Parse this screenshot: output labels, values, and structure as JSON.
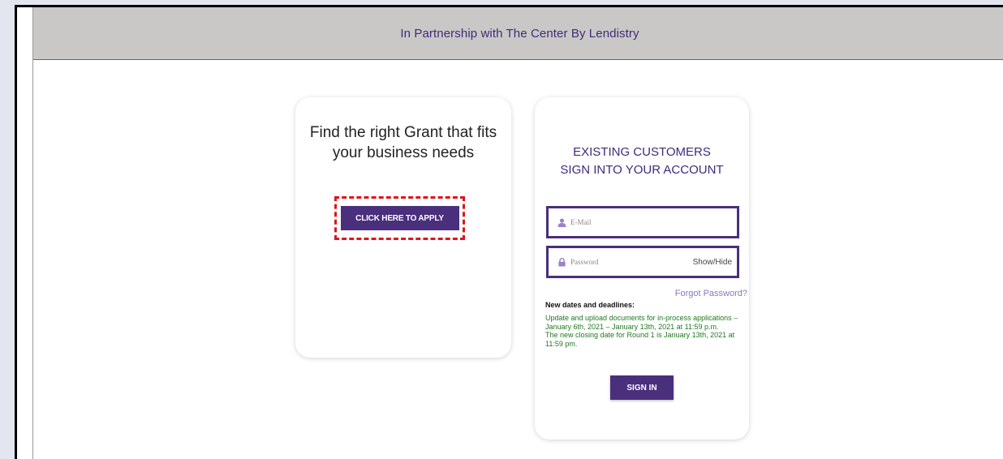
{
  "banner": {
    "text": "In Partnership with The Center By Lendistry"
  },
  "grant_card": {
    "heading": "Find the right Grant that fits your business needs",
    "apply_button_label": "CLICK HERE TO APPLY"
  },
  "login_card": {
    "title_line1": "EXISTING CUSTOMERS",
    "title_line2": "SIGN INTO YOUR ACCOUNT",
    "email_placeholder": "E-Mail",
    "password_placeholder": "Password",
    "show_hide_label": "Show/Hide",
    "forgot_label": "Forgot Password?",
    "notice_heading": "New dates and deadlines:",
    "notice_line1": "Update and upload documents for in-process applications – January 6th, 2021 – January 13th, 2021 at 11:59 p.m.",
    "notice_line2": "The new closing date for Round 1 is January 13th, 2021 at 11:59 pm.",
    "signin_label": "SIGN IN"
  },
  "colors": {
    "brand": "#4a2f7c",
    "highlight": "#e0141b",
    "notice": "#1e7a1e",
    "banner_bg": "#c9c8c6"
  },
  "icons": {
    "email": "user-icon",
    "password": "lock-icon"
  }
}
